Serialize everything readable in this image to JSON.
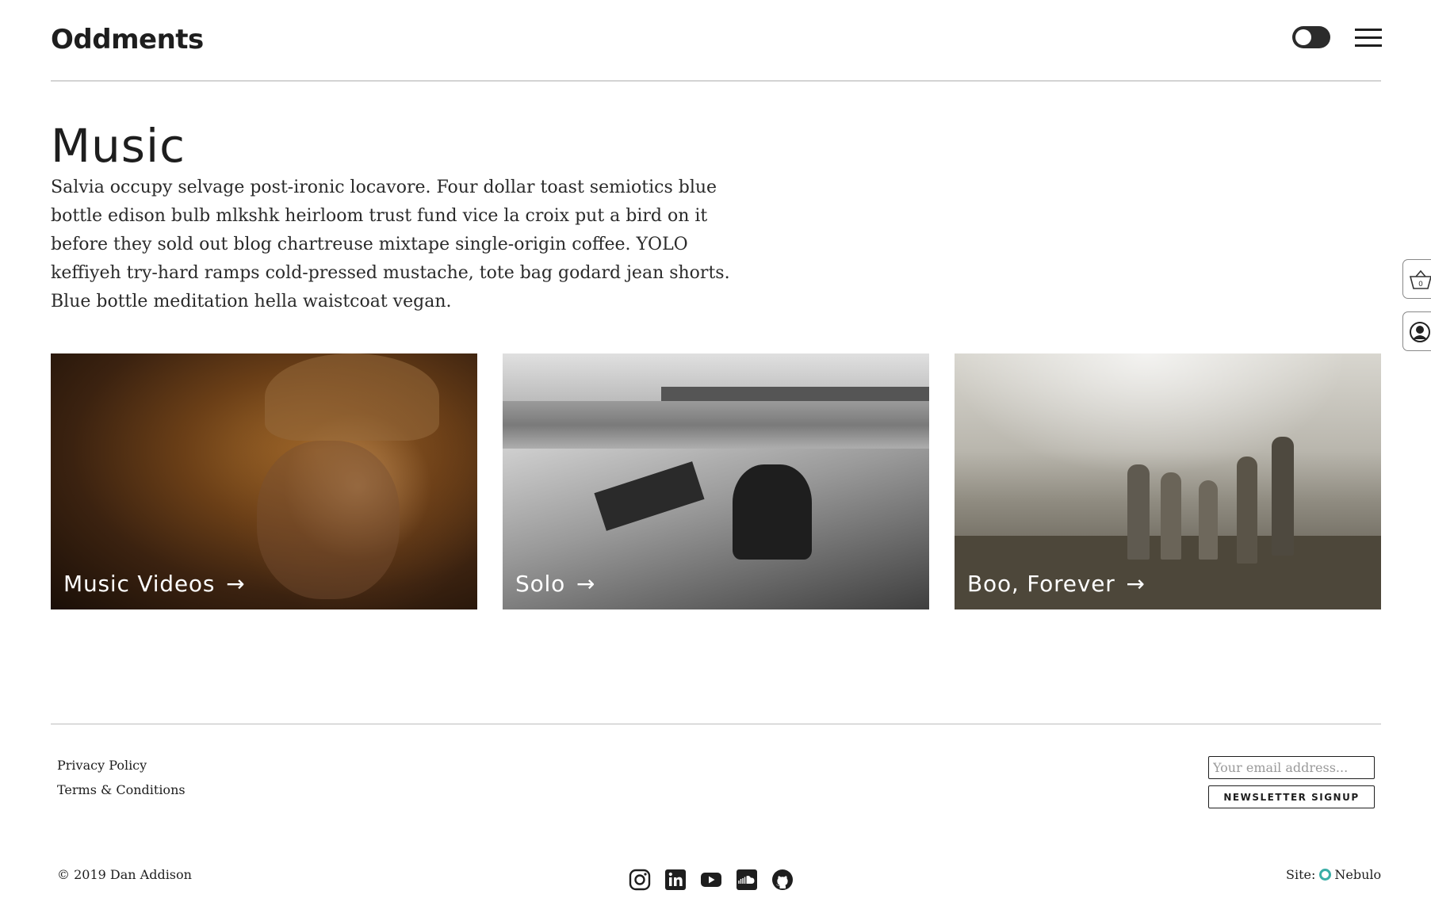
{
  "header": {
    "site_title": "Oddments",
    "theme_toggle_icon": "toggle-switch-icon",
    "menu_icon": "hamburger-menu-icon"
  },
  "main": {
    "title": "Music",
    "intro": "Salvia occupy selvage post-ironic locavore. Four dollar toast semiotics blue bottle edison bulb mlkshk heirloom trust fund vice la croix put a bird on it before they sold out blog chartreuse mixtape single-origin coffee. YOLO keffiyeh try-hard ramps cold-pressed mustache, tote bag godard jean shorts. Blue bottle meditation hella waistcoat vegan.",
    "cards": [
      {
        "label": "Music Videos",
        "arrow": "→"
      },
      {
        "label": "Solo",
        "arrow": "→"
      },
      {
        "label": "Boo, Forever",
        "arrow": "→"
      }
    ]
  },
  "side_tabs": {
    "cart_icon": "basket-icon",
    "cart_count": "0",
    "account_icon": "user-account-icon"
  },
  "footer": {
    "links": [
      "Privacy Policy",
      "Terms & Conditions"
    ],
    "email_placeholder": "Your email address...",
    "signup_label": "NEWSLETTER SIGNUP",
    "copyright": "© 2019 Dan Addison",
    "social_icons": [
      "instagram-icon",
      "linkedin-icon",
      "youtube-icon",
      "soundcloud-icon",
      "github-icon"
    ],
    "site_label": "Site:",
    "site_name": "Nebulo",
    "site_brand_color": "#3aaea7"
  }
}
